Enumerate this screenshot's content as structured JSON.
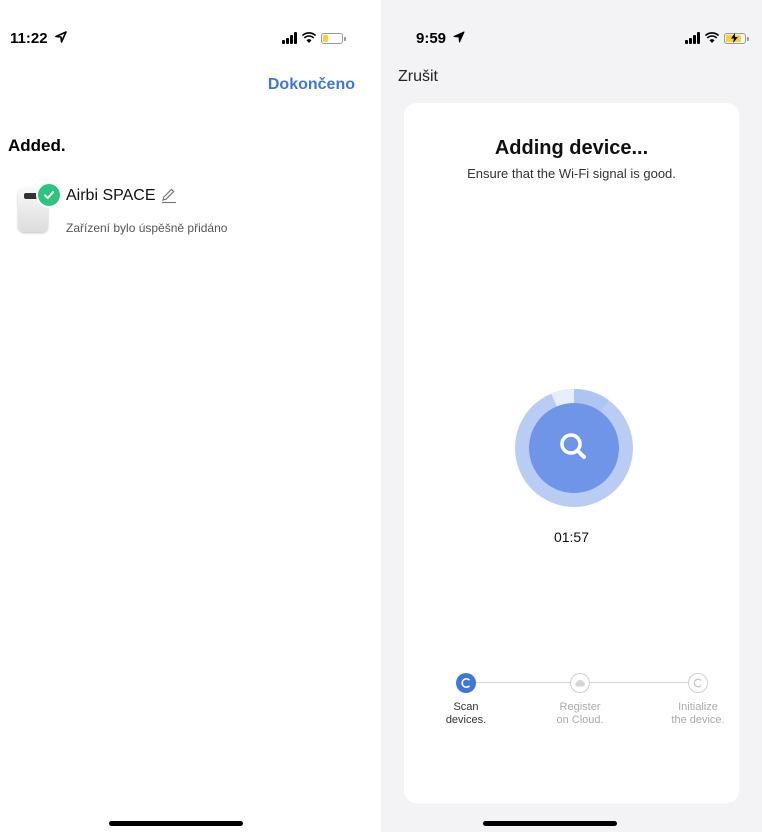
{
  "left_screen": {
    "status_bar": {
      "time": "11:22",
      "battery_color": "#f3d23a"
    },
    "nav": {
      "done_label": "Dokončeno"
    },
    "heading": "Added.",
    "device": {
      "name": "Airbi SPACE",
      "status": "Zařízení bylo úspěšně přidáno"
    }
  },
  "right_screen": {
    "status_bar": {
      "time": "9:59",
      "battery_color": "#f3d23a"
    },
    "nav": {
      "cancel_label": "Zrušit"
    },
    "card": {
      "title": "Adding device...",
      "subtitle": "Ensure that the Wi-Fi signal is good.",
      "timer": "01:57",
      "steps": [
        {
          "label_line1": "Scan",
          "label_line2": "devices.",
          "state": "active",
          "icon": "scan-icon"
        },
        {
          "label_line1": "Register",
          "label_line2": "on Cloud.",
          "state": "pending",
          "icon": "cloud-icon"
        },
        {
          "label_line1": "Initialize",
          "label_line2": "the device.",
          "state": "pending",
          "icon": "initialize-icon"
        }
      ]
    }
  },
  "colors": {
    "accent_blue": "#3f77d8",
    "progress_inner": "#6f95e8",
    "progress_outer": "#b9cdf4",
    "success_green": "#2fc47d"
  }
}
